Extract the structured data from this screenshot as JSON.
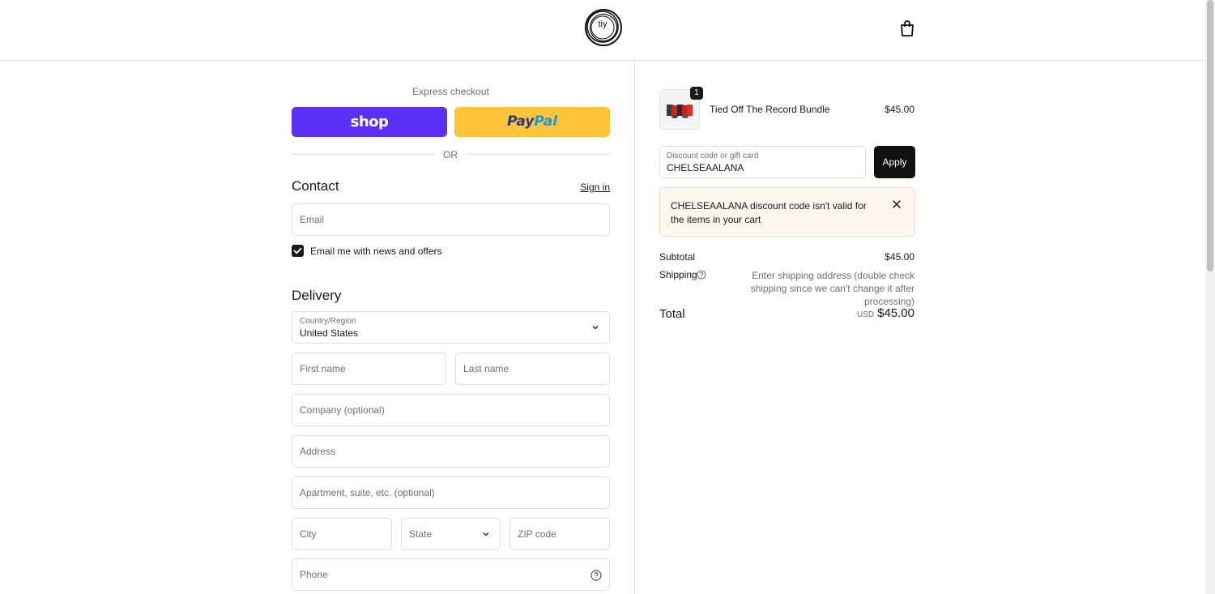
{
  "header": {
    "logo_text": "tiy",
    "logo_mark": "spiral-logo",
    "cart_icon": "shopping-bag-icon"
  },
  "express": {
    "title": "Express checkout",
    "shop_label": "shop",
    "paypal_label_1": "Pay",
    "paypal_label_2": "Pal",
    "or_label": "OR",
    "shop_color": "#5a31f4",
    "paypal_color": "#ffc439"
  },
  "contact": {
    "title": "Contact",
    "sign_in": "Sign in",
    "email_placeholder": "Email",
    "newsletter_label": "Email me with news and offers",
    "newsletter_checked": true
  },
  "delivery": {
    "title": "Delivery",
    "country_label": "Country/Region",
    "country_value": "United States",
    "first_name": "First name",
    "last_name": "Last name",
    "company": "Company (optional)",
    "address": "Address",
    "apartment": "Apartment, suite, etc. (optional)",
    "city": "City",
    "state": "State",
    "zip": "ZIP code",
    "phone": "Phone"
  },
  "summary": {
    "item": {
      "quantity": "1",
      "name": "Tied Off The Record Bundle",
      "price": "$45.00"
    },
    "discount": {
      "label": "Discount code or gift card",
      "value": "CHELSEAALANA",
      "apply": "Apply"
    },
    "error": "CHELSEAALANA discount code isn't valid for the items in your cart",
    "subtotal_label": "Subtotal",
    "subtotal_value": "$45.00",
    "shipping_label": "Shipping",
    "shipping_note": "Enter shipping address (double check shipping since we can't change it after processing)",
    "total_label": "Total",
    "currency": "USD",
    "total_value": "$45.00"
  }
}
